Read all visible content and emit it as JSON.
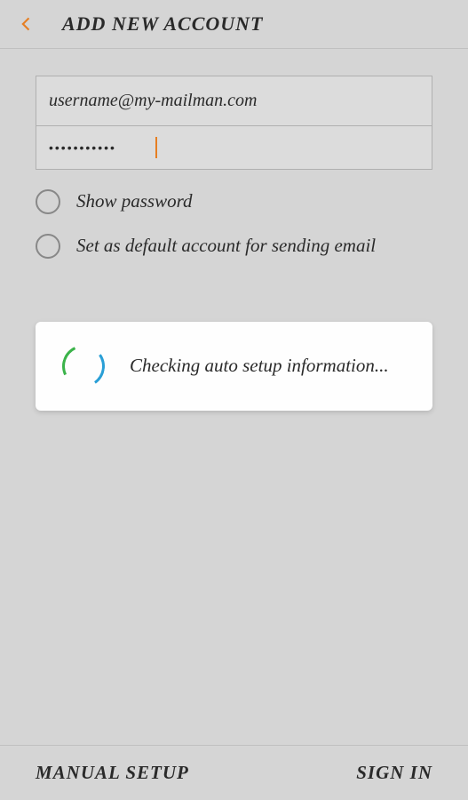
{
  "header": {
    "title": "ADD NEW ACCOUNT"
  },
  "form": {
    "email_value": "username@my-mailman.com",
    "password_value": "•••••••••••",
    "show_password_label": "Show password",
    "default_account_label": "Set as default account for sending email"
  },
  "loading": {
    "message": "Checking auto setup information..."
  },
  "footer": {
    "manual_setup": "MANUAL SETUP",
    "sign_in": "SIGN IN"
  },
  "colors": {
    "accent": "#e67e22",
    "spinner_green": "#3bb34a",
    "spinner_blue": "#2a9fd6"
  }
}
